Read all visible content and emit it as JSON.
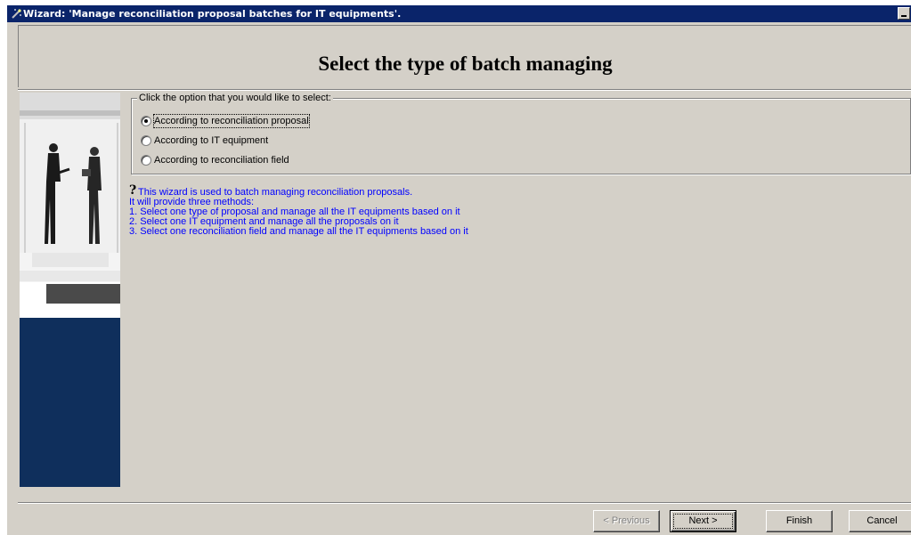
{
  "window": {
    "title": "Wizard: 'Manage reconciliation proposal batches for IT equipments'."
  },
  "header": {
    "heading": "Select the type of batch managing"
  },
  "options": {
    "group_label": "Click the option that you would like to select:",
    "items": [
      {
        "label": "According to reconciliation proposal",
        "checked": true
      },
      {
        "label": "According to IT equipment",
        "checked": false
      },
      {
        "label": "According to reconciliation field",
        "checked": false
      }
    ]
  },
  "info": {
    "icon": "help-icon",
    "lines": [
      "This wizard is used to batch managing reconciliation proposals.",
      "It will provide three methods:",
      "1. Select one type of proposal and manage all the IT equipments based on it",
      "2. Select one IT equipment and manage all the proposals on it",
      "3. Select one reconciliation field and manage all the IT equipments based on it"
    ]
  },
  "buttons": {
    "previous": "< Previous",
    "next": "Next >",
    "finish": "Finish",
    "cancel": "Cancel"
  },
  "colors": {
    "titlebar": "#0a246a",
    "face": "#d4d0c8",
    "info_text": "#0000ff",
    "side_panel": "#0f2f5c"
  }
}
